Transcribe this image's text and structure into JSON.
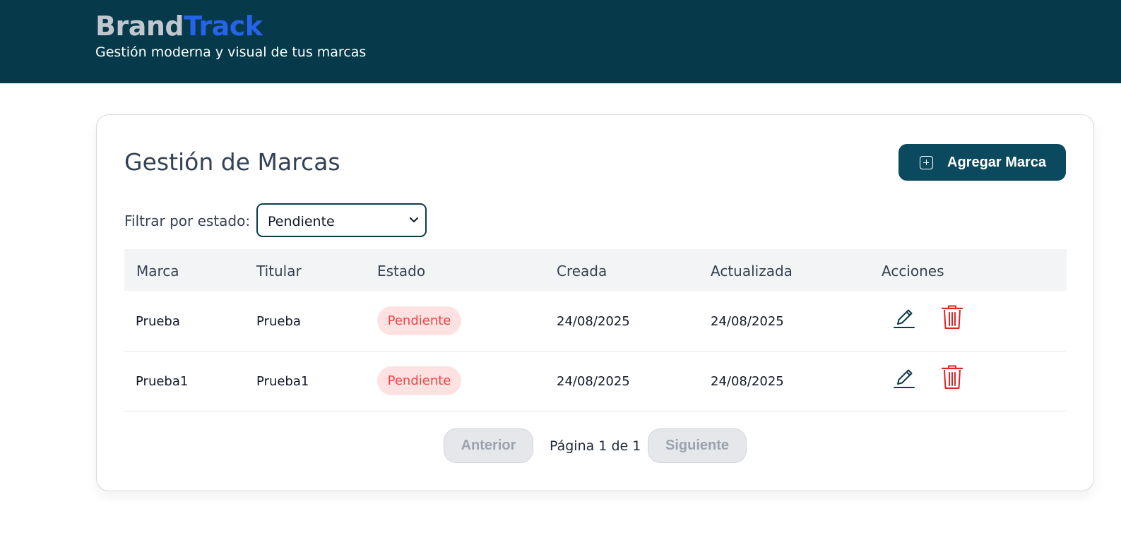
{
  "header": {
    "brand_part1": "Brand",
    "brand_part2": "Track",
    "tagline": "Gestión moderna y visual de tus marcas"
  },
  "main": {
    "title": "Gestión de Marcas",
    "add_button_label": "Agregar Marca",
    "filter": {
      "label": "Filtrar por estado:",
      "selected": "Pendiente"
    },
    "table": {
      "columns": [
        "Marca",
        "Titular",
        "Estado",
        "Creada",
        "Actualizada",
        "Acciones"
      ],
      "rows": [
        {
          "marca": "Prueba",
          "titular": "Prueba",
          "estado": "Pendiente",
          "creada": "24/08/2025",
          "actualizada": "24/08/2025"
        },
        {
          "marca": "Prueba1",
          "titular": "Prueba1",
          "estado": "Pendiente",
          "creada": "24/08/2025",
          "actualizada": "24/08/2025"
        }
      ]
    },
    "pagination": {
      "prev_label": "Anterior",
      "page_text": "Página 1 de 1",
      "next_label": "Siguiente"
    }
  },
  "colors": {
    "header_bg": "#063a4a",
    "brand_accent": "#2563eb",
    "primary_button": "#0b4a5e",
    "badge_pending_bg": "#fee2e2",
    "badge_pending_text": "#ef4444",
    "delete_icon": "#dc2626"
  },
  "icons": {
    "add": "plus-square-icon",
    "select": "chevron-down-icon",
    "edit": "pencil-icon",
    "delete": "trash-icon"
  }
}
